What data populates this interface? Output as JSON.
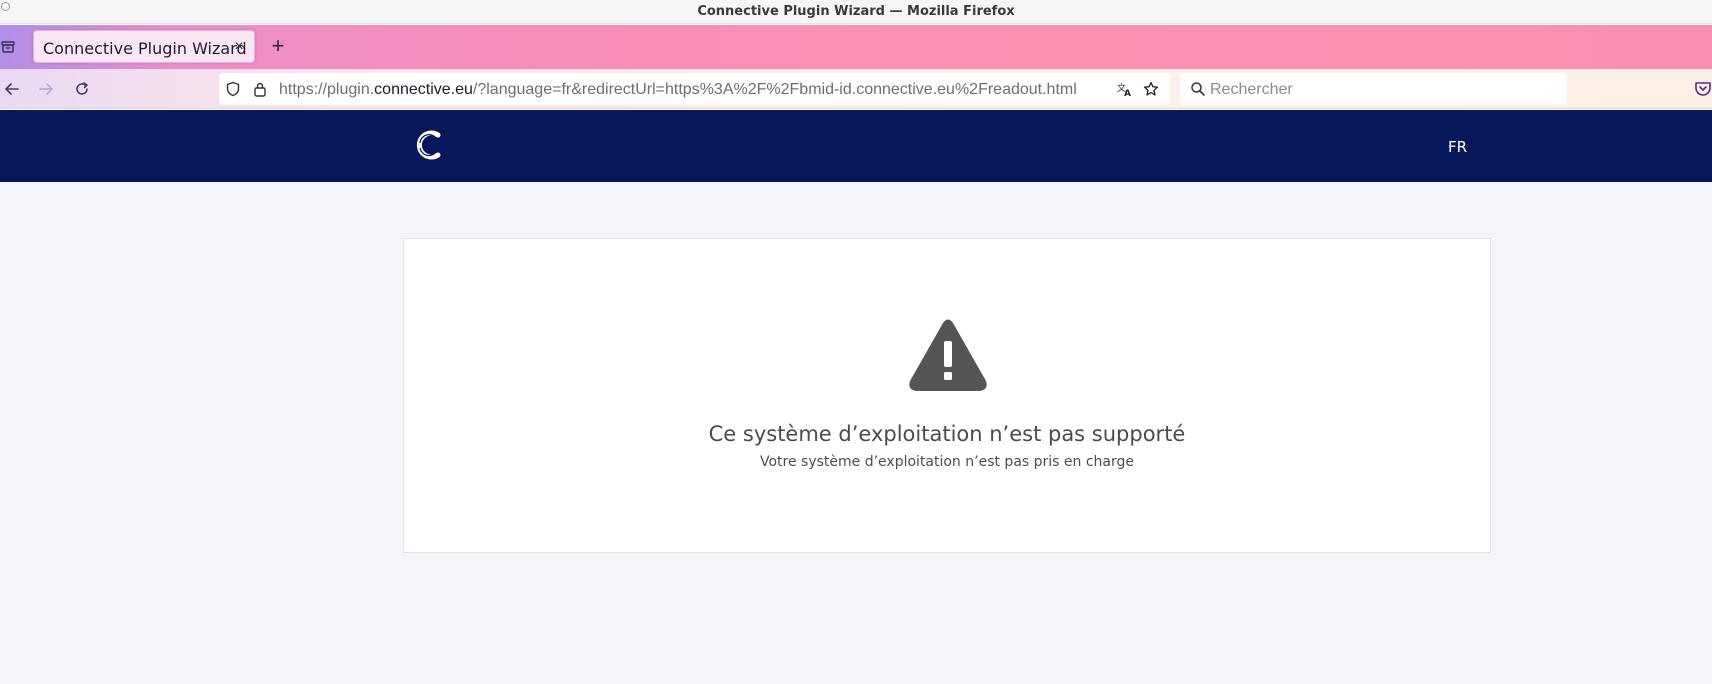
{
  "window": {
    "title": "Connective Plugin Wizard — Mozilla Firefox"
  },
  "tabs": [
    {
      "title": "Connective Plugin Wizard",
      "close_label": "×",
      "active": true
    }
  ],
  "newtab_label": "+",
  "toolbar": {
    "icons": [
      "back-arrow-icon",
      "forward-arrow-icon",
      "reload-icon",
      "shield-icon",
      "lock-icon",
      "translate-icon",
      "star-icon",
      "search-icon",
      "pocket-icon"
    ]
  },
  "urlbar": {
    "prefix": "https://plugin.",
    "host": "connective.eu",
    "suffix": "/?language=fr&redirectUrl=https%3A%2F%2Fbmid-id.connective.eu%2Freadout.html"
  },
  "search": {
    "placeholder": "Rechercher"
  },
  "site": {
    "header_bg": "#08165a",
    "language": "FR",
    "logo_icon": "connective-logo-icon"
  },
  "error": {
    "icon": "warning-triangle-icon",
    "title": "Ce système d’exploitation n’est pas supporté",
    "subtitle": "Votre système d’exploitation n’est pas pris en charge"
  }
}
